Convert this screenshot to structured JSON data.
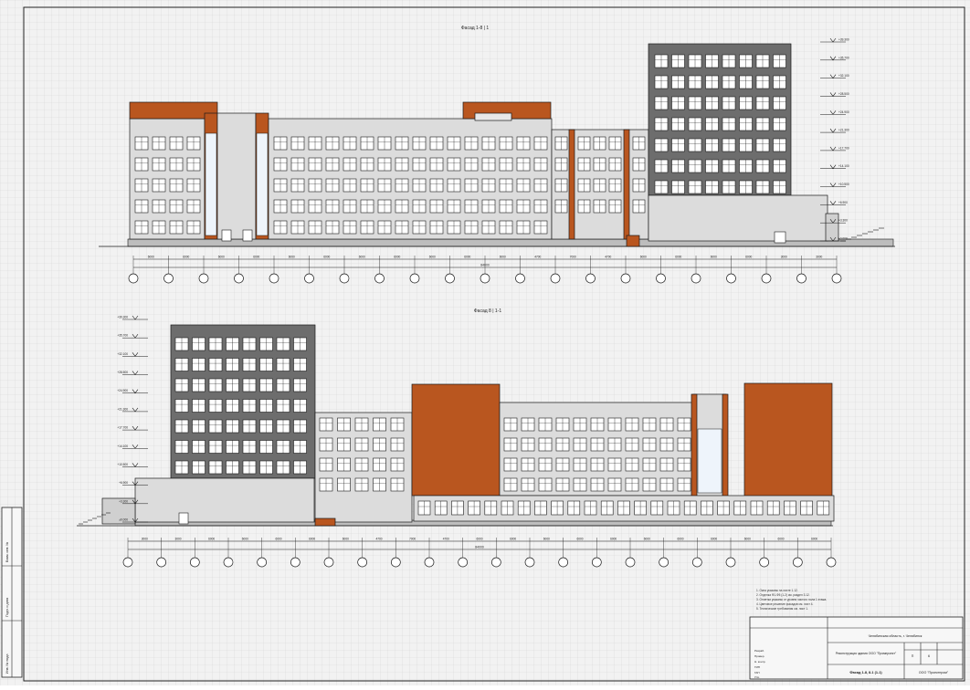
{
  "drawing": {
    "facade_top_title": "Фасад 1-8 | 1",
    "facade_bottom_title": "Фасад 8 | 1-1"
  },
  "axes_top": {
    "spans": [
      "6000",
      "6000",
      "6000",
      "6000",
      "6000",
      "6000",
      "6000",
      "6000",
      "6000",
      "6000",
      "6000",
      "4700",
      "7000",
      "4700",
      "6000",
      "6000",
      "6000",
      "6000",
      "3000",
      "3000"
    ],
    "total": "84000"
  },
  "axes_bottom": {
    "spans": [
      "3000",
      "3000",
      "6000",
      "6000",
      "6000",
      "6000",
      "6000",
      "4700",
      "7000",
      "4700",
      "6000",
      "6000",
      "6000",
      "6000",
      "6000",
      "6000",
      "6000",
      "6000",
      "6000",
      "6000",
      "6000"
    ],
    "total": "84000"
  },
  "level_marks": {
    "top": [
      "+39.300",
      "+35.700",
      "+32.100",
      "+28.500",
      "+24.900",
      "+21.300",
      "+17.700",
      "+14.100",
      "+10.500",
      "+6.900",
      "+3.300",
      "±0.000"
    ],
    "bottom": [
      "+39.300",
      "+35.700",
      "+32.100",
      "+28.500",
      "+24.900",
      "+21.300",
      "+17.700",
      "+14.100",
      "+10.500",
      "+6.900",
      "+3.300",
      "±0.000"
    ]
  },
  "notes": [
    "1. Окна указаны на листе 1.12.",
    "2. Отделка Ф1-Ф5 (1-2) см. раздел 3.12.",
    "3. Отметки указаны от уровня чистого пола 1 этажа.",
    "4. Цветовое решение фасадов см. лист 4.",
    "5. Технические требования см. лист 1."
  ],
  "title_block": {
    "header": "Челябинская область, г. Челябинск",
    "project": "Реконструкция здания ООО \"Промпроект\"",
    "stage": "П",
    "sheet": "6",
    "sheets": "",
    "sheet_title": "Фасад 1-8, 8-1 (1-1)",
    "org": "ООО \"Проектпром\"",
    "roles": [
      "Разраб.",
      "Провер.",
      "Н. контр.",
      "ГИП",
      "ГАП",
      "Утв."
    ]
  },
  "side_stamp": {
    "labels": [
      "Инв. № подл.",
      "Подп. и дата",
      "Взам. инв. №"
    ]
  },
  "colors": {
    "background": "#f2f2f2",
    "grid": "#d9d9d9",
    "tower_dark": "#6d6d6d",
    "body_light": "#dcdcdc",
    "accent_orange": "#b9561f",
    "window": "#ffffff",
    "line": "#1a1a1a"
  }
}
